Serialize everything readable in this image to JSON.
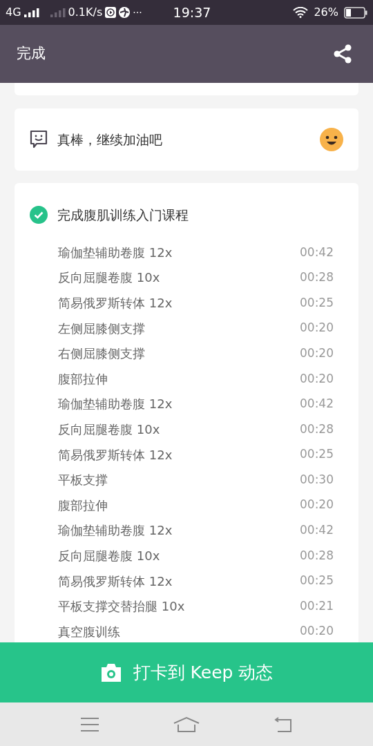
{
  "status_bar": {
    "network": "4G",
    "speed": "0.1K/s",
    "more": "···",
    "time": "19:37",
    "battery": "26%"
  },
  "header": {
    "title": "完成"
  },
  "encouragement": {
    "text": "真棒，继续加油吧"
  },
  "course": {
    "title": "完成腹肌训练入门课程",
    "completed": true,
    "exercises": [
      {
        "name": "瑜伽垫辅助卷腹 12x",
        "time": "00:42"
      },
      {
        "name": "反向屈腿卷腹 10x",
        "time": "00:28"
      },
      {
        "name": "简易俄罗斯转体 12x",
        "time": "00:25"
      },
      {
        "name": "左侧屈膝侧支撑",
        "time": "00:20"
      },
      {
        "name": "右侧屈膝侧支撑",
        "time": "00:20"
      },
      {
        "name": "腹部拉伸",
        "time": "00:20"
      },
      {
        "name": "瑜伽垫辅助卷腹 12x",
        "time": "00:42"
      },
      {
        "name": "反向屈腿卷腹 10x",
        "time": "00:28"
      },
      {
        "name": "简易俄罗斯转体 12x",
        "time": "00:25"
      },
      {
        "name": "平板支撑",
        "time": "00:30"
      },
      {
        "name": "腹部拉伸",
        "time": "00:20"
      },
      {
        "name": "瑜伽垫辅助卷腹 12x",
        "time": "00:42"
      },
      {
        "name": "反向屈腿卷腹 10x",
        "time": "00:28"
      },
      {
        "name": "简易俄罗斯转体 12x",
        "time": "00:25"
      },
      {
        "name": "平板支撑交替抬腿 10x",
        "time": "00:21"
      },
      {
        "name": "真空腹训练",
        "time": "00:20"
      }
    ]
  },
  "checkin_button": {
    "label": "打卡到 Keep 动态"
  }
}
